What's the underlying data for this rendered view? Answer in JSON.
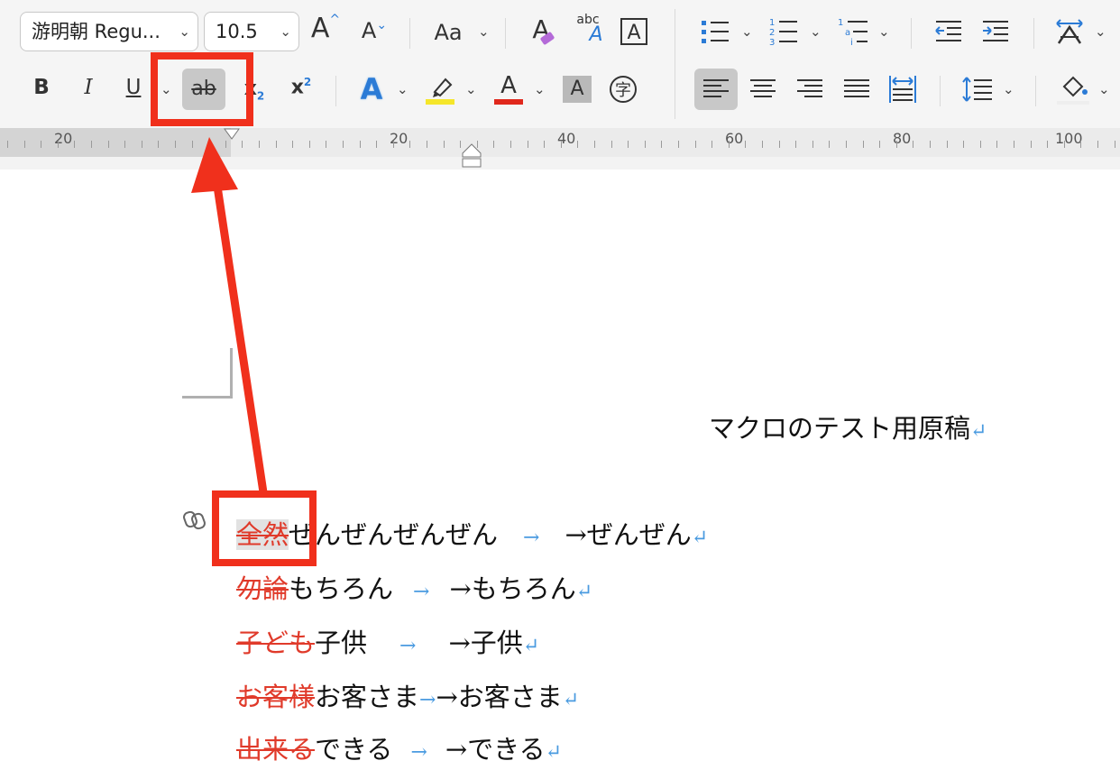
{
  "ribbon": {
    "font_name": "游明朝 Regu...",
    "font_size": "10.5",
    "grow_font": "A",
    "shrink_font": "A",
    "change_case": "Aa",
    "clear_format": "A",
    "phonetic_top": "abc",
    "phonetic_bottom": "A",
    "char_border": "A",
    "bold": "B",
    "italic": "I",
    "underline": "U",
    "strikethrough": "ab",
    "subscript": "x",
    "subscript_mark": "2",
    "superscript": "x",
    "superscript_mark": "2",
    "text_effects": "A",
    "font_color": "A",
    "char_shading": "A",
    "enclose_char": "字",
    "colors": {
      "highlight": "#f5e62a",
      "font_color_bar": "#e0281c",
      "annotation": "#f0301c",
      "list_blue": "#2b7bd6"
    }
  },
  "ruler": {
    "labels": [
      "20",
      "20",
      "40",
      "60",
      "80",
      "100"
    ]
  },
  "document": {
    "title": "マクロのテスト用原稿",
    "return_mark": "↵",
    "tab_mark": "→",
    "lines": [
      {
        "struck": "全然",
        "rest": "ぜんぜんぜんぜん",
        "result": "→ぜんぜん"
      },
      {
        "struck": "勿論",
        "rest": "もちろん",
        "result": "→もちろん"
      },
      {
        "struck": "子ども",
        "rest": "子供",
        "result": "→子供"
      },
      {
        "struck": "お客様",
        "rest": "お客さま",
        "result": "→お客さま"
      },
      {
        "struck": "出来る",
        "rest": "できる",
        "result": "→できる"
      }
    ]
  }
}
